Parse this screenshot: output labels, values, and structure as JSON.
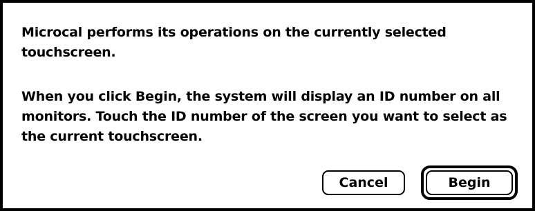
{
  "dialog": {
    "message_1": "Microcal performs its operations on the currently selected touchscreen.",
    "message_2": "When you click Begin, the system will display an ID number on all monitors. Touch the ID number of the screen you want to select as the current touchscreen.",
    "cancel_label": "Cancel",
    "begin_label": "Begin",
    "default_button": "Begin"
  }
}
